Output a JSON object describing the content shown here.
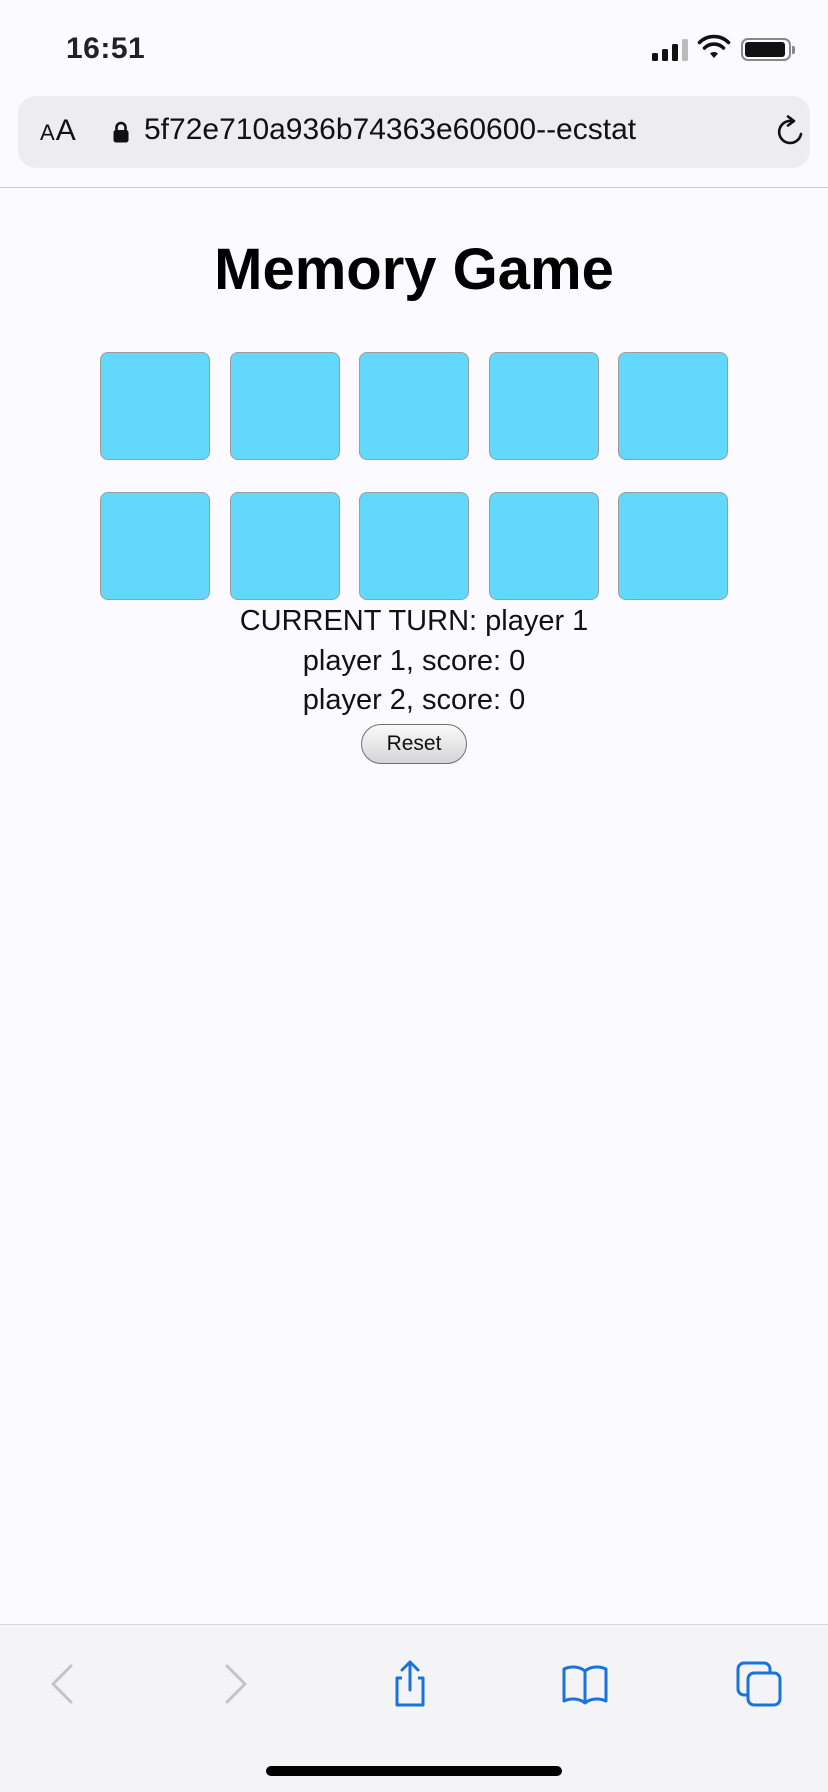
{
  "status_bar": {
    "time": "16:51",
    "icons": [
      "signal-icon",
      "wifi-icon",
      "battery-icon"
    ]
  },
  "browser": {
    "text_size_label": "AA",
    "url": "5f72e710a936b74363e60600--ecstat",
    "icons": [
      "lock-icon",
      "reload-icon"
    ]
  },
  "page": {
    "title": "Memory Game",
    "cards": [
      {
        "state": "face-down"
      },
      {
        "state": "face-down"
      },
      {
        "state": "face-down"
      },
      {
        "state": "face-down"
      },
      {
        "state": "face-down"
      },
      {
        "state": "face-down"
      },
      {
        "state": "face-down"
      },
      {
        "state": "face-down"
      },
      {
        "state": "face-down"
      },
      {
        "state": "face-down"
      }
    ],
    "card_color": "#62d8fc",
    "current_turn": "CURRENT TURN: player 1",
    "player1_score": "player 1, score: 0",
    "player2_score": "player 2, score: 0",
    "reset_label": "Reset"
  },
  "toolbar": {
    "icons": [
      "back-icon",
      "forward-icon",
      "share-icon",
      "bookmarks-icon",
      "tabs-icon"
    ],
    "accent_color": "#1a73d9",
    "disabled_color": "#c4c4c8"
  }
}
